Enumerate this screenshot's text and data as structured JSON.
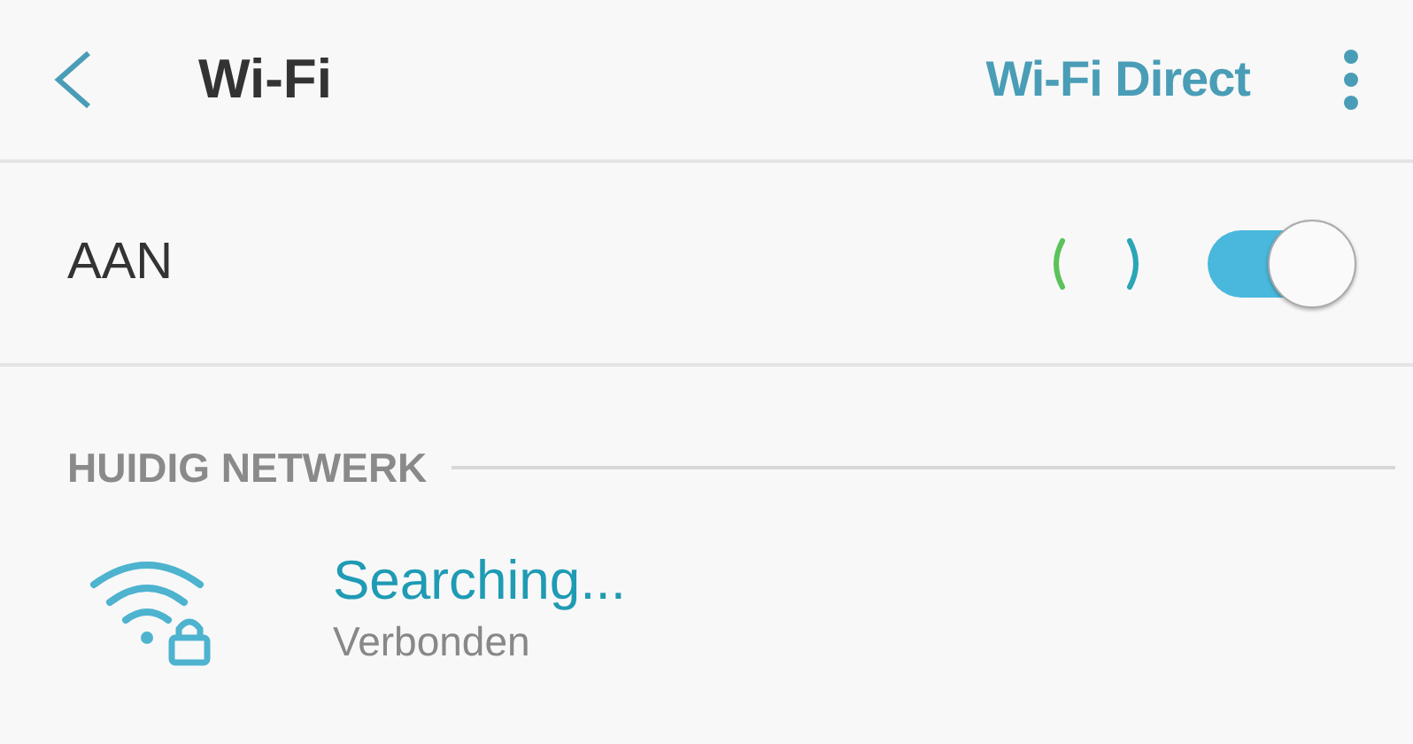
{
  "header": {
    "title": "Wi-Fi",
    "action": "Wi-Fi Direct"
  },
  "master_switch": {
    "label": "AAN",
    "on": true
  },
  "section": {
    "title": "HUIDIG NETWERK"
  },
  "networks": [
    {
      "name": "Searching...",
      "status": "Verbonden",
      "secured": true
    }
  ]
}
